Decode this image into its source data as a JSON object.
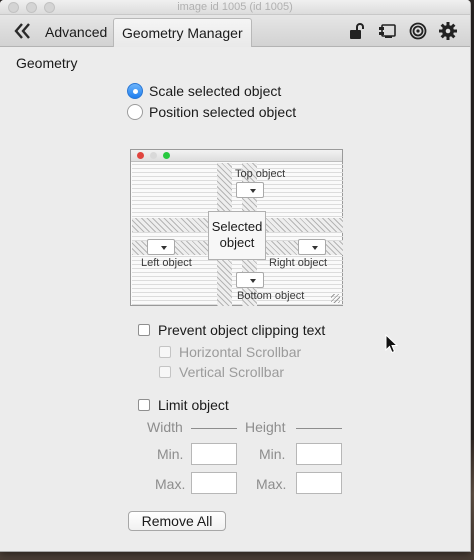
{
  "window": {
    "title": "image id 1005 (id 1005)"
  },
  "toolbar": {
    "back_icon": "double-chevron-left-icon",
    "tabs": [
      {
        "label": "Advanced",
        "active": false
      },
      {
        "label": "Geometry Manager",
        "active": true
      }
    ],
    "icons": [
      "unlock-icon",
      "display-icon",
      "target-icon",
      "gear-icon"
    ]
  },
  "geometry": {
    "section_title": "Geometry",
    "radio_options": [
      {
        "label": "Scale selected object",
        "selected": true
      },
      {
        "label": "Position selected object",
        "selected": false
      }
    ],
    "diagram": {
      "top_label": "Top object",
      "left_label": "Left object",
      "right_label": "Right object",
      "bottom_label": "Bottom object",
      "selected_label_line1": "Selected",
      "selected_label_line2": "object"
    },
    "prevent_clipping": {
      "label": "Prevent object clipping text",
      "checked": false,
      "sub_options": [
        {
          "label": "Horizontal Scrollbar",
          "checked": false,
          "enabled": false
        },
        {
          "label": "Vertical Scrollbar",
          "checked": false,
          "enabled": false
        }
      ]
    },
    "limit": {
      "label": "Limit object",
      "checked": false,
      "width_header": "Width",
      "height_header": "Height",
      "min_label": "Min.",
      "max_label": "Max.",
      "width_min": "",
      "width_max": "",
      "height_min": "",
      "height_max": ""
    },
    "remove_all_label": "Remove All"
  },
  "colors": {
    "accent": "#1f7ff0",
    "window_bg": "#ececec",
    "disabled_text": "#9b9b9b"
  }
}
